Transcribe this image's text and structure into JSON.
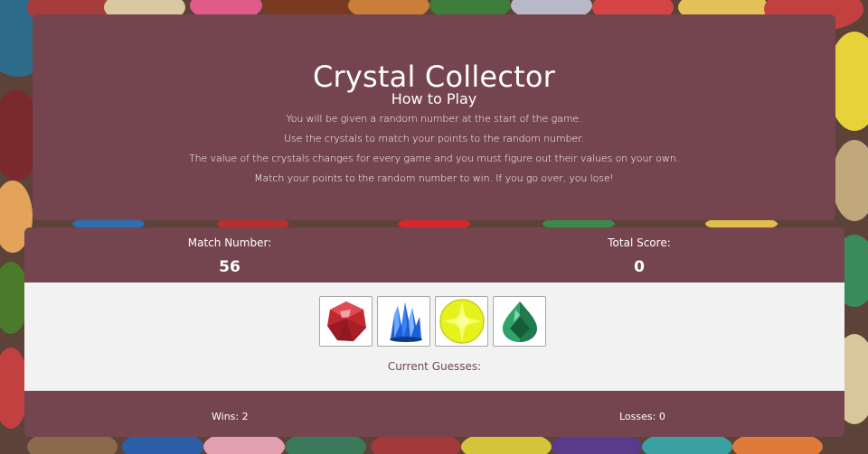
{
  "game": {
    "title": "Crystal Collector",
    "howto_heading": "How to Play",
    "rules": [
      "You will be given a random number at the start of the game.",
      "Use the crystals to match your points to the random number.",
      "The value of the crystals changes for every game and you must figure out their values on your own.",
      "Match your points to the random number to win. If you go over, you lose!"
    ]
  },
  "scoreboard": {
    "match_label": "Match Number:",
    "match_value": "56",
    "total_label": "Total Score:",
    "total_value": "0",
    "guesses_label": "Current Guesses:",
    "wins": "Wins: 2",
    "losses": "Losses: 0"
  },
  "crystals": [
    {
      "icon": "red-gem-icon",
      "color": "#c1272d"
    },
    {
      "icon": "blue-crystal-icon",
      "color": "#1d5fd6"
    },
    {
      "icon": "yellow-gem-icon",
      "color": "#e6f21e"
    },
    {
      "icon": "green-gem-icon",
      "color": "#1f7a4d"
    }
  ],
  "colors": {
    "panel": "#74454f",
    "crystal_area": "#f2f2f2",
    "text_light": "#ffffff"
  }
}
